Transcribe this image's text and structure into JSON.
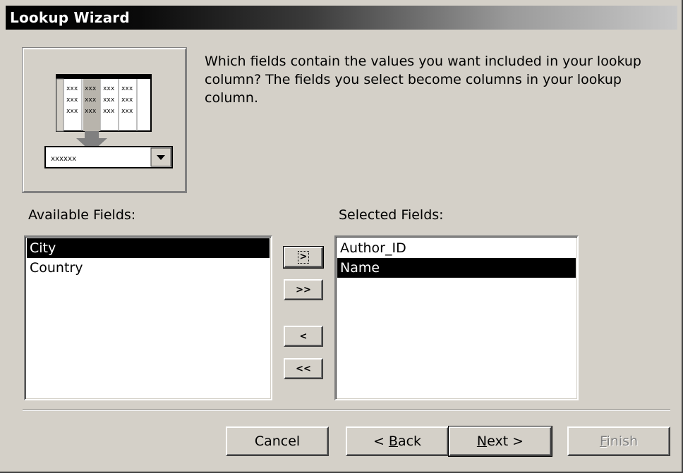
{
  "window": {
    "title": "Lookup Wizard"
  },
  "illustration": {
    "icon": "lookup-combo-illustration-icon",
    "grid_cell_text": "xxx",
    "combo_text": "xxxxxx"
  },
  "prompt": {
    "text": "Which fields contain the values you want included in your lookup column? The fields you select become columns in your lookup column."
  },
  "available_fields": {
    "label": "Available Fields:",
    "items": [
      {
        "text": "City",
        "selected": true
      },
      {
        "text": "Country",
        "selected": false
      }
    ]
  },
  "selected_fields": {
    "label": "Selected Fields:",
    "items": [
      {
        "text": "Author_ID",
        "selected": false
      },
      {
        "text": "Name",
        "selected": true
      }
    ]
  },
  "move_buttons": {
    "add_one": ">",
    "add_all": ">>",
    "remove_one": "<",
    "remove_all": "<<"
  },
  "footer": {
    "cancel": "Cancel",
    "back_prefix": "< ",
    "back_accel": "B",
    "back_rest": "ack",
    "next_accel": "N",
    "next_rest": "ext >",
    "finish_accel": "F",
    "finish_rest": "inish",
    "finish_enabled": false
  },
  "colors": {
    "face": "#d4d0c8",
    "selection": "#000000",
    "title_start": "#000000",
    "title_end": "#c8c8c8"
  }
}
